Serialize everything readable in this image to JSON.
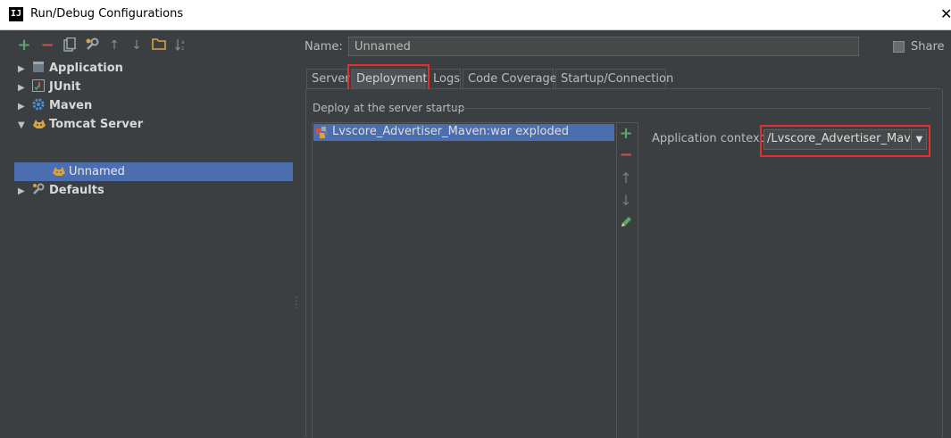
{
  "window": {
    "app_icon": "IJ",
    "title": "Run/Debug Configurations",
    "close_glyph": "✕"
  },
  "toolbar": {
    "add": "+",
    "remove": "−",
    "copy_icon": "copy-icon",
    "edit_icon": "wrench-icon",
    "up": "↑",
    "down": "↓",
    "folder_icon": "folder-icon",
    "sort_icon": "sort-icon"
  },
  "tree": {
    "items": [
      {
        "label": "Application",
        "expanded": false
      },
      {
        "label": "JUnit",
        "expanded": false
      },
      {
        "label": "Maven",
        "expanded": false
      },
      {
        "label": "Tomcat Server",
        "expanded": true
      },
      {
        "label": "Unnamed",
        "selected": true
      },
      {
        "label": "Defaults",
        "expanded": false
      }
    ]
  },
  "config": {
    "name_label": "Name:",
    "name_value": "Unnamed",
    "share_label": "Share"
  },
  "tabs": [
    {
      "label": "Server"
    },
    {
      "label": "Deployment",
      "active": true
    },
    {
      "label": "Logs"
    },
    {
      "label": "Code Coverage"
    },
    {
      "label": "Startup/Connection"
    }
  ],
  "deployment": {
    "caption": "Deploy at the server startup",
    "artifacts": [
      "Lvscore_Advertiser_Maven:war exploded"
    ],
    "context_label": "Application context:",
    "context_value": "/Lvscore_Advertiser_Maven"
  },
  "colors": {
    "background": "#3c3f41",
    "selection": "#4b6eaf",
    "highlight": "#e03030",
    "add_green": "#59a869",
    "remove_red": "#c75450"
  }
}
